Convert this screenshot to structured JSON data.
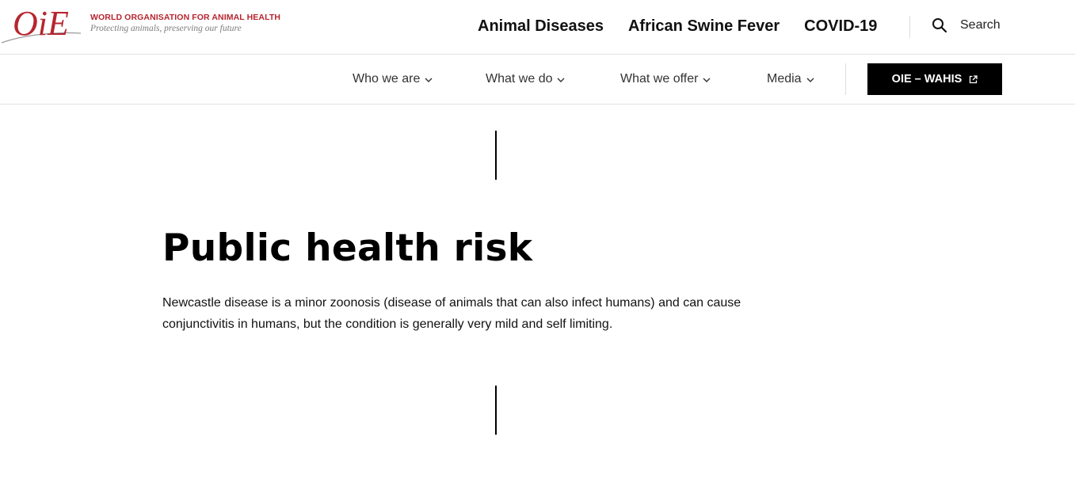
{
  "logo": {
    "mark": "OiE",
    "org_name": "WORLD ORGANISATION FOR ANIMAL HEALTH",
    "tagline": "Protecting animals, preserving our future"
  },
  "quick_links": [
    "Animal Diseases",
    "African Swine Fever",
    "COVID-19"
  ],
  "search": {
    "label": "Search",
    "icon": "search-icon"
  },
  "nav": {
    "items": [
      {
        "label": "Who we are",
        "icon": "chevron-down-icon"
      },
      {
        "label": "What we do",
        "icon": "chevron-down-icon"
      },
      {
        "label": "What we offer",
        "icon": "chevron-down-icon"
      },
      {
        "label": "Media",
        "icon": "chevron-down-icon"
      }
    ],
    "cta": {
      "label": "OIE – WAHIS",
      "icon": "external-link-icon"
    }
  },
  "content": {
    "title": "Public health risk",
    "body": "Newcastle disease is a minor zoonosis (disease of animals that can also infect humans) and can cause conjunctivitis in humans, but the condition is generally very mild and self limiting."
  },
  "colors": {
    "brand_red": "#b7252f",
    "tagline_gray": "#7c7c7c",
    "cta_background": "#000000",
    "divider": "#e2e2e2"
  }
}
